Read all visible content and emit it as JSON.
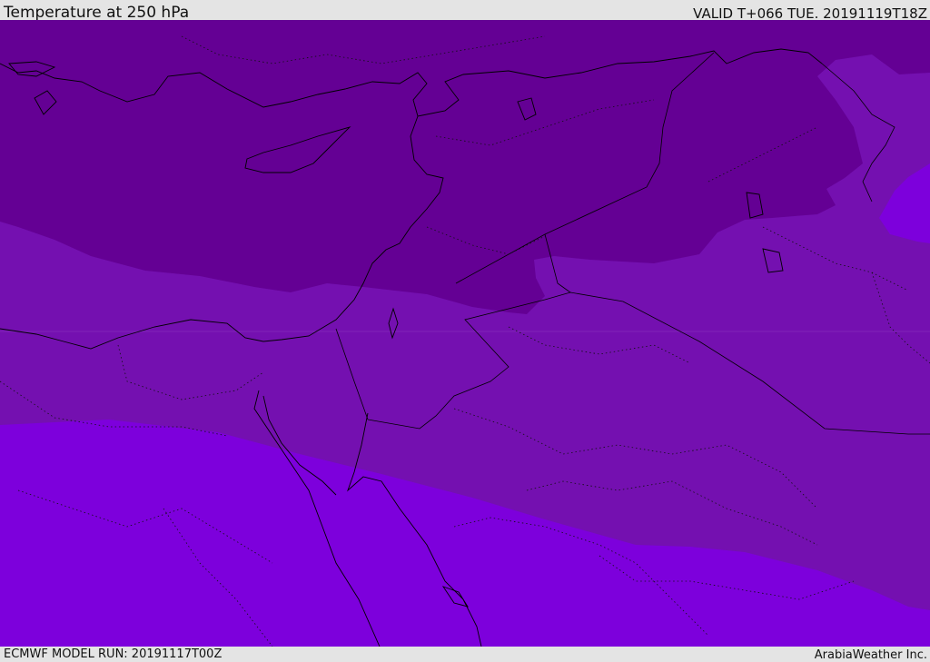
{
  "header": {
    "title": "Temperature at 250 hPa",
    "valid_time": "VALID T+066 TUE. 20191119T18Z"
  },
  "footer": {
    "model_run": "ECMWF MODEL RUN: 20191117T00Z",
    "credit": "ArabiaWeather Inc."
  },
  "map": {
    "fill_colors": {
      "coldest": "#640094",
      "cold": "#7410b0",
      "mid": "#7d00dc",
      "bright": "#7a10c8",
      "boundary_line": "#000000"
    }
  }
}
